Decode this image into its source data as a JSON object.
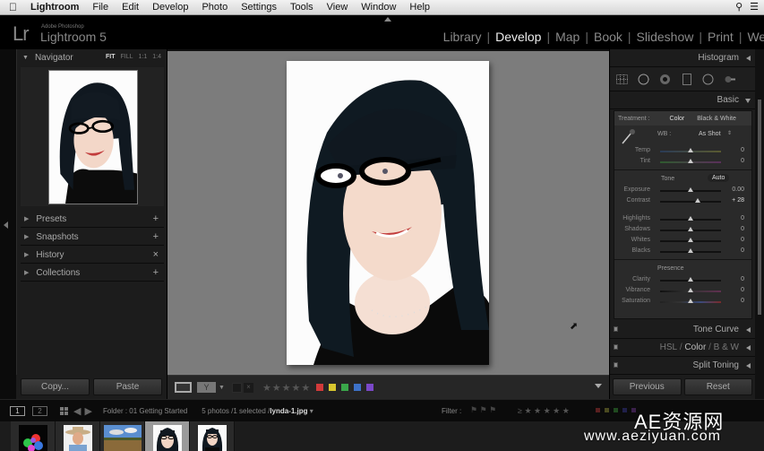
{
  "menubar": {
    "app": "Lightroom",
    "items": [
      "File",
      "Edit",
      "Develop",
      "Photo",
      "Settings",
      "Tools",
      "View",
      "Window",
      "Help"
    ]
  },
  "identity": {
    "vendor": "Adobe Photoshop",
    "product": "Lightroom 5",
    "logo": "Lr"
  },
  "modules": [
    {
      "label": "Library",
      "active": false
    },
    {
      "label": "Develop",
      "active": true
    },
    {
      "label": "Map",
      "active": false
    },
    {
      "label": "Book",
      "active": false
    },
    {
      "label": "Slideshow",
      "active": false
    },
    {
      "label": "Print",
      "active": false
    },
    {
      "label": "Web",
      "active": false
    }
  ],
  "left_panel": {
    "navigator": {
      "title": "Navigator",
      "zoom_options": [
        "FIT",
        "FILL",
        "1:1",
        "1:4"
      ],
      "selected_zoom": "FIT"
    },
    "sections": [
      {
        "label": "Presets",
        "action": "+"
      },
      {
        "label": "Snapshots",
        "action": "+"
      },
      {
        "label": "History",
        "action": "×"
      },
      {
        "label": "Collections",
        "action": "+"
      }
    ],
    "copy_label": "Copy...",
    "paste_label": "Paste"
  },
  "toolbar": {
    "stars": "★★★★★",
    "color_labels": [
      "#d23a3a",
      "#d8c62e",
      "#3aa64a",
      "#3d72c8",
      "#7a48c8"
    ]
  },
  "right_panel": {
    "histogram_title": "Histogram",
    "basic_title": "Basic",
    "treatment_label": "Treatment :",
    "treatment_color": "Color",
    "treatment_bw": "Black & White",
    "wb_label": "WB :",
    "wb_value": "As Shot",
    "tone_label": "Tone",
    "auto_label": "Auto",
    "presence_label": "Presence",
    "sliders": {
      "temp": {
        "label": "Temp",
        "value": "0",
        "pos": 0.5
      },
      "tint": {
        "label": "Tint",
        "value": "0",
        "pos": 0.5
      },
      "exposure": {
        "label": "Exposure",
        "value": "0.00",
        "pos": 0.5
      },
      "contrast": {
        "label": "Contrast",
        "value": "+ 28",
        "pos": 0.62
      },
      "highlights": {
        "label": "Highlights",
        "value": "0",
        "pos": 0.5
      },
      "shadows": {
        "label": "Shadows",
        "value": "0",
        "pos": 0.5
      },
      "whites": {
        "label": "Whites",
        "value": "0",
        "pos": 0.5
      },
      "blacks": {
        "label": "Blacks",
        "value": "0",
        "pos": 0.5
      },
      "clarity": {
        "label": "Clarity",
        "value": "0",
        "pos": 0.5
      },
      "vibrance": {
        "label": "Vibrance",
        "value": "0",
        "pos": 0.5
      },
      "saturation": {
        "label": "Saturation",
        "value": "0",
        "pos": 0.5
      }
    },
    "tone_curve_title": "Tone Curve",
    "hsl_title": {
      "hsl": "HSL",
      "sep1": " / ",
      "color": "Color",
      "sep2": " / ",
      "bw": "B & W"
    },
    "split_toning_title": "Split Toning",
    "previous_label": "Previous",
    "reset_label": "Reset"
  },
  "filmbar": {
    "screen1": "1",
    "screen2": "2",
    "folder": "Folder : 01 Getting Started",
    "count": "5 photos /1 selected /",
    "filename": "lynda-1.jpg",
    "filter_label": "Filter :"
  },
  "filmstrip": {
    "thumbs": [
      "balloons",
      "man-with-hat",
      "landscape",
      "woman-portrait-1",
      "woman-portrait-2"
    ],
    "selected_index": 3
  },
  "watermark": {
    "line1": "AE资源网",
    "line2": "www.aeziyuan.com"
  }
}
